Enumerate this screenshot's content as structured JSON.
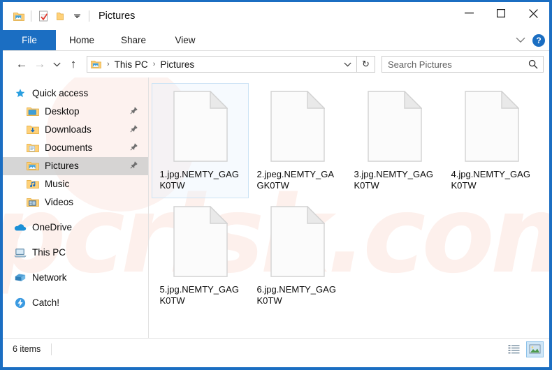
{
  "window": {
    "title": "Pictures",
    "quick_access_toolbar": [
      {
        "name": "pictures-folder-icon",
        "label": "Pictures"
      },
      {
        "name": "properties-icon",
        "label": "Properties"
      },
      {
        "name": "new-folder-icon",
        "label": "New folder"
      },
      {
        "name": "customize-chevron-icon",
        "label": "Customize Quick Access Toolbar"
      }
    ],
    "controls": {
      "minimize": "–",
      "maximize": "□",
      "close": "✕"
    }
  },
  "ribbon": {
    "tabs": [
      {
        "label": "File",
        "active": true
      },
      {
        "label": "Home",
        "active": false
      },
      {
        "label": "Share",
        "active": false
      },
      {
        "label": "View",
        "active": false
      }
    ],
    "expand_label": "∨",
    "help_label": "?"
  },
  "address": {
    "back": "←",
    "forward": "→",
    "recent": "∨",
    "up": "↑",
    "breadcrumb": [
      "This PC",
      "Pictures"
    ],
    "separator": "›",
    "dropdown": "∨",
    "refresh": "↻"
  },
  "search": {
    "placeholder": "Search Pictures",
    "value": "",
    "icon": "search-icon"
  },
  "sidebar": {
    "items": [
      {
        "label": "Quick access",
        "icon": "star-icon",
        "level": "root",
        "pinned": false,
        "selected": false
      },
      {
        "label": "Desktop",
        "icon": "desktop-folder-icon",
        "level": "child",
        "pinned": true,
        "selected": false
      },
      {
        "label": "Downloads",
        "icon": "downloads-folder-icon",
        "level": "child",
        "pinned": true,
        "selected": false
      },
      {
        "label": "Documents",
        "icon": "documents-folder-icon",
        "level": "child",
        "pinned": true,
        "selected": false
      },
      {
        "label": "Pictures",
        "icon": "pictures-folder-icon",
        "level": "child",
        "pinned": true,
        "selected": true
      },
      {
        "label": "Music",
        "icon": "music-folder-icon",
        "level": "child",
        "pinned": false,
        "selected": false
      },
      {
        "label": "Videos",
        "icon": "videos-folder-icon",
        "level": "child",
        "pinned": false,
        "selected": false
      },
      {
        "label": "OneDrive",
        "icon": "onedrive-cloud-icon",
        "level": "root",
        "pinned": false,
        "selected": false,
        "gap_before": true
      },
      {
        "label": "This PC",
        "icon": "this-pc-icon",
        "level": "root",
        "pinned": false,
        "selected": false,
        "gap_before": true
      },
      {
        "label": "Network",
        "icon": "network-icon",
        "level": "root",
        "pinned": false,
        "selected": false,
        "gap_before": true
      },
      {
        "label": "Catch!",
        "icon": "catch-icon",
        "level": "root",
        "pinned": false,
        "selected": false,
        "gap_before": true
      }
    ]
  },
  "files": [
    {
      "name": "1.jpg.NEMTY_GAGK0TW",
      "icon": "generic-file-icon",
      "selected": true
    },
    {
      "name": "2.jpeg.NEMTY_GAGK0TW",
      "icon": "generic-file-icon",
      "selected": false
    },
    {
      "name": "3.jpg.NEMTY_GAGK0TW",
      "icon": "generic-file-icon",
      "selected": false
    },
    {
      "name": "4.jpg.NEMTY_GAGK0TW",
      "icon": "generic-file-icon",
      "selected": false
    },
    {
      "name": "5.jpg.NEMTY_GAGK0TW",
      "icon": "generic-file-icon",
      "selected": false
    },
    {
      "name": "6.jpg.NEMTY_GAGK0TW",
      "icon": "generic-file-icon",
      "selected": false
    }
  ],
  "status": {
    "item_count": "6 items",
    "view_buttons": [
      {
        "name": "details-view-button",
        "active": false
      },
      {
        "name": "large-icons-view-button",
        "active": true
      }
    ]
  },
  "watermark": {
    "text": "pcrisk.com"
  },
  "colors": {
    "accent": "#1b6ec2",
    "selection_border": "#cce3f5",
    "sidebar_selected": "#cdcdcd",
    "folder_yellow": "#ffd179",
    "watermark": "#fdf0ec"
  }
}
